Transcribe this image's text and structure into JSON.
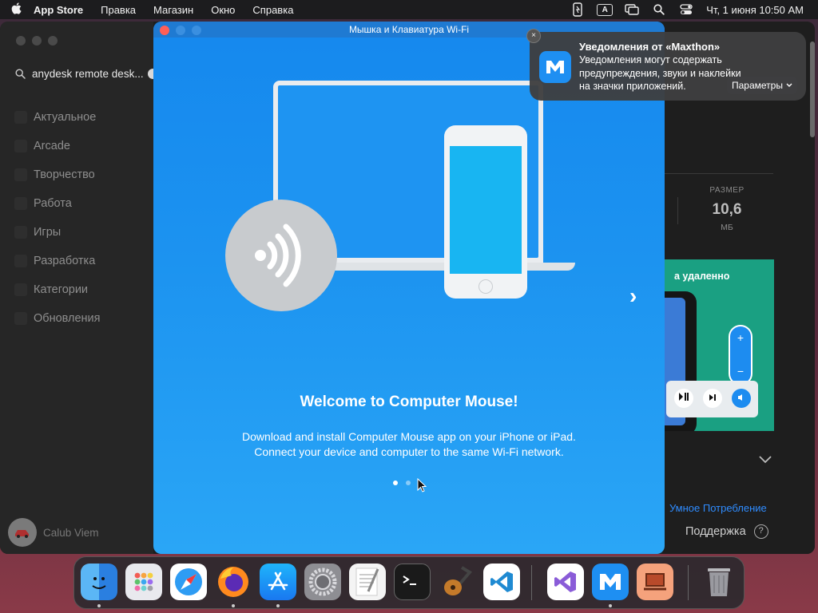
{
  "menubar": {
    "app_name": "App Store",
    "items": [
      "Правка",
      "Магазин",
      "Окно",
      "Справка"
    ],
    "clock": "Чт, 1 июня  10:50 AM",
    "input_letter": "A"
  },
  "appstore": {
    "search_value": "anydesk remote desk...",
    "nav_items": [
      "Актуальное",
      "Arcade",
      "Творчество",
      "Работа",
      "Игры",
      "Разработка",
      "Категории",
      "Обновления"
    ],
    "user_name": "Calub Viem",
    "size_label": "РАЗМЕР",
    "size_value": "10,6",
    "size_unit": "МБ",
    "promo_text": "а удаленно",
    "promo_plus": "+",
    "promo_minus": "−",
    "link_text": "Умное Потребление",
    "support_text": "Поддержка",
    "help_glyph": "?"
  },
  "welcome_window": {
    "title": "Мышка и Клавиатура Wi-Fi",
    "heading": "Welcome to Computer Mouse!",
    "description_line1": "Download and install Computer Mouse app on your iPhone or iPad.",
    "description_line2": "Connect your device and computer to the same Wi-Fi network.",
    "pages_total": 2,
    "current_page": 1,
    "next_glyph": "›"
  },
  "notification": {
    "title": "Уведомления от «Maxthon»",
    "body": "Уведомления могут содержать предупреждения, звуки и наклейки на значки приложений.",
    "button_label": "Параметры",
    "close_glyph": "×"
  },
  "dock": {
    "apps": [
      "Finder",
      "Launchpad",
      "Safari",
      "Firefox",
      "App Store",
      "System Preferences",
      "TextEdit",
      "Terminal",
      "GarageBand",
      "Visual Studio Code",
      "Visual Studio",
      "Maxthon",
      "Remote Desktop",
      "Trash"
    ]
  },
  "colors": {
    "accent": "#1e8ff2",
    "welcome_bg": "#1c93f0",
    "link": "#2f8cff",
    "promo": "#1aa082"
  }
}
